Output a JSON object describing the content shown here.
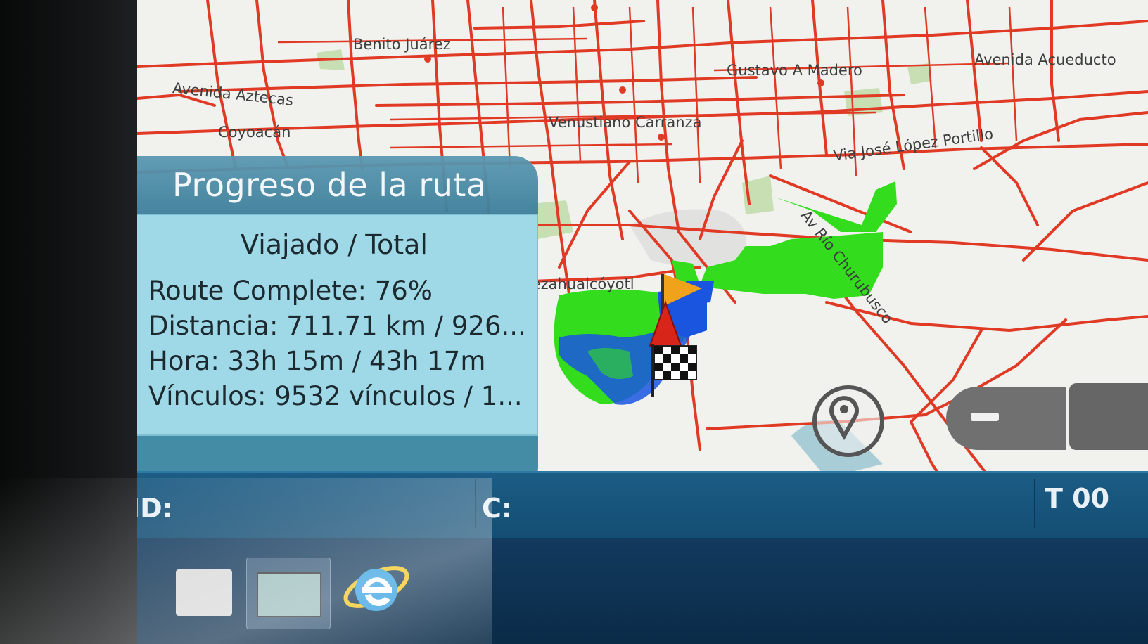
{
  "map": {
    "labels": [
      {
        "text": "Benito Juárez"
      },
      {
        "text": "Avenida Aztecas"
      },
      {
        "text": "Coyoacán"
      },
      {
        "text": "Gustavo A Madero"
      },
      {
        "text": "Avenida Acueducto"
      },
      {
        "text": "Venustiano Carranza"
      },
      {
        "text": "Via José López Portillo"
      },
      {
        "text": "Av Río Churubusco"
      },
      {
        "text": "Nezahualcóyotl"
      }
    ],
    "colors": {
      "road": "#e03a25",
      "background": "#f1f1ee",
      "park": "#c8dfb4",
      "track_green": "#33dd1e",
      "track_blue": "#1a55e0"
    }
  },
  "route_panel": {
    "title": "Progreso de la ruta",
    "subtitle": "Viajado / Total",
    "route_complete": "Route Complete: 76%",
    "distance": "Distancia: 711.71 km / 926...",
    "time": "Hora: 33h 15m / 43h 17m",
    "links": "Vínculos: 9532 vínculos / 1..."
  },
  "status_bar": {
    "id_label": "ID:",
    "c_label": "C:",
    "t_label": "T 00"
  },
  "icons": {
    "locate": "map-pin-locate-icon",
    "zoom_out": "minus-icon",
    "browser": "internet-explorer-icon",
    "start_flag": "orange-flag-icon",
    "position": "red-arrow-icon",
    "finish_flag": "checkered-flag-icon"
  }
}
